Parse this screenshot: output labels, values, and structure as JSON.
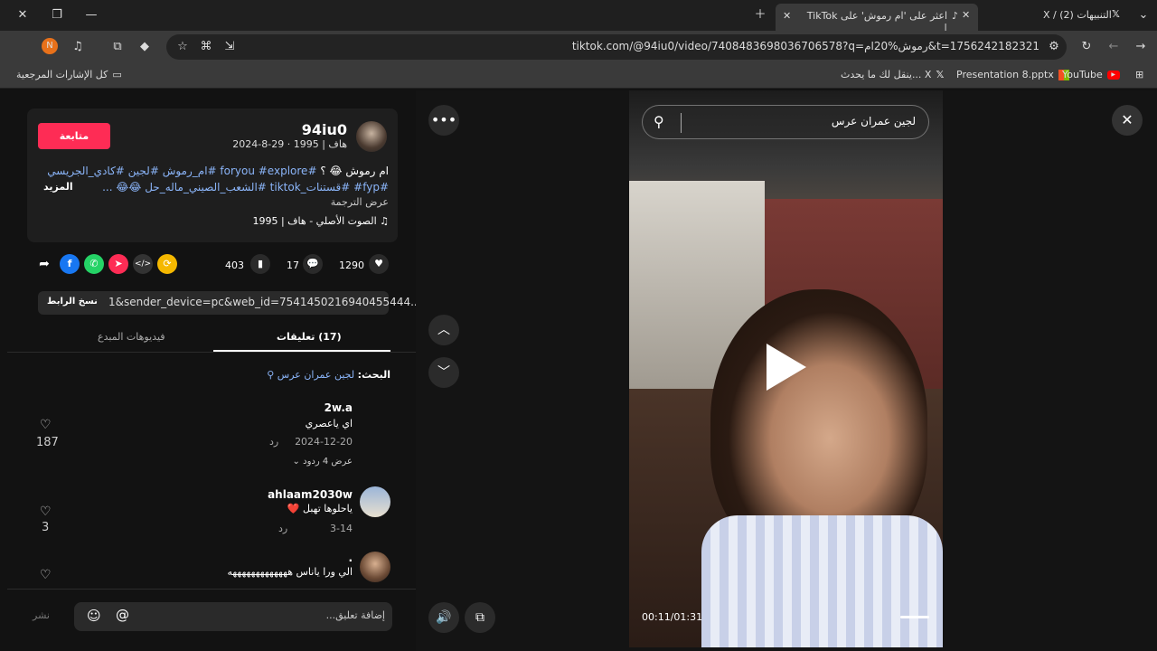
{
  "browser": {
    "tabs": [
      {
        "label": "X / التنبيهات (2)",
        "icon": "x-logo-icon"
      },
      {
        "label": "اعثر على 'ام رموش' على TikTok |",
        "icon": "tiktok-icon"
      }
    ],
    "url": "tiktok.com/@94iu0/video/7408483698036706578?q=رموش%20ام&t=1756242182321",
    "bookmarks": [
      {
        "label": "YouTube"
      },
      {
        "label": "Presentation 8.pptx"
      },
      {
        "label": "ينقل لك ما يحدث... X"
      },
      {
        "label": "كل الإشارات المرجعية"
      }
    ],
    "profile_initial": "N"
  },
  "post": {
    "follow_label": "متابعة",
    "username": "94iu0",
    "subline": "هاف | 1995 · 29-8-2024",
    "caption_text": "ام رموش 😂 ؟",
    "hashtags_line1": "#foryou #explore #ام_رموش #لجين #كادي_الجريسي",
    "hashtags_line2": "#fyp# #قستنات_tiktok #الشعب_الصيني_ماله_حل 😂😂 ...",
    "more_label": "المزيد",
    "translate_label": "عرض الترجمة",
    "sound_label": "الصوت الأصلي - هاف | 1995"
  },
  "stats": {
    "likes": "1290",
    "comments": "17",
    "saves": "403"
  },
  "share": {
    "link_text": "1&sender_device=pc&web_id=7541450216940455444...",
    "copy_label": "نسخ الرابط"
  },
  "tabs": {
    "comments_label": "(17) تعليقات",
    "creator_videos_label": "فيديوهات المبدع"
  },
  "search": {
    "prefix": "البحث:",
    "query": "لجين عمران عرس"
  },
  "comments": [
    {
      "user": "2w.a",
      "text": "اي ياعصري",
      "date": "2024-12-20",
      "reply_label": "رد",
      "likes": "187",
      "replies_label": "عرض 4 ردود"
    },
    {
      "user": "ahlaam2030w",
      "text": "ياحلوها تهبل ❤️",
      "date": "3-14",
      "reply_label": "رد",
      "likes": "3"
    },
    {
      "user": ".",
      "text": "الي ورا ياناس هههههههههههههه",
      "likes": ""
    }
  ],
  "composer": {
    "placeholder": "إضافة تعليق...",
    "post_label": "نشر"
  },
  "video": {
    "search_text": "لجين عمران عرس",
    "time": "00:11/01:31",
    "progress": 0.12
  },
  "colors": {
    "accent": "#fe2c55",
    "hashtag": "#8ab4f8"
  }
}
